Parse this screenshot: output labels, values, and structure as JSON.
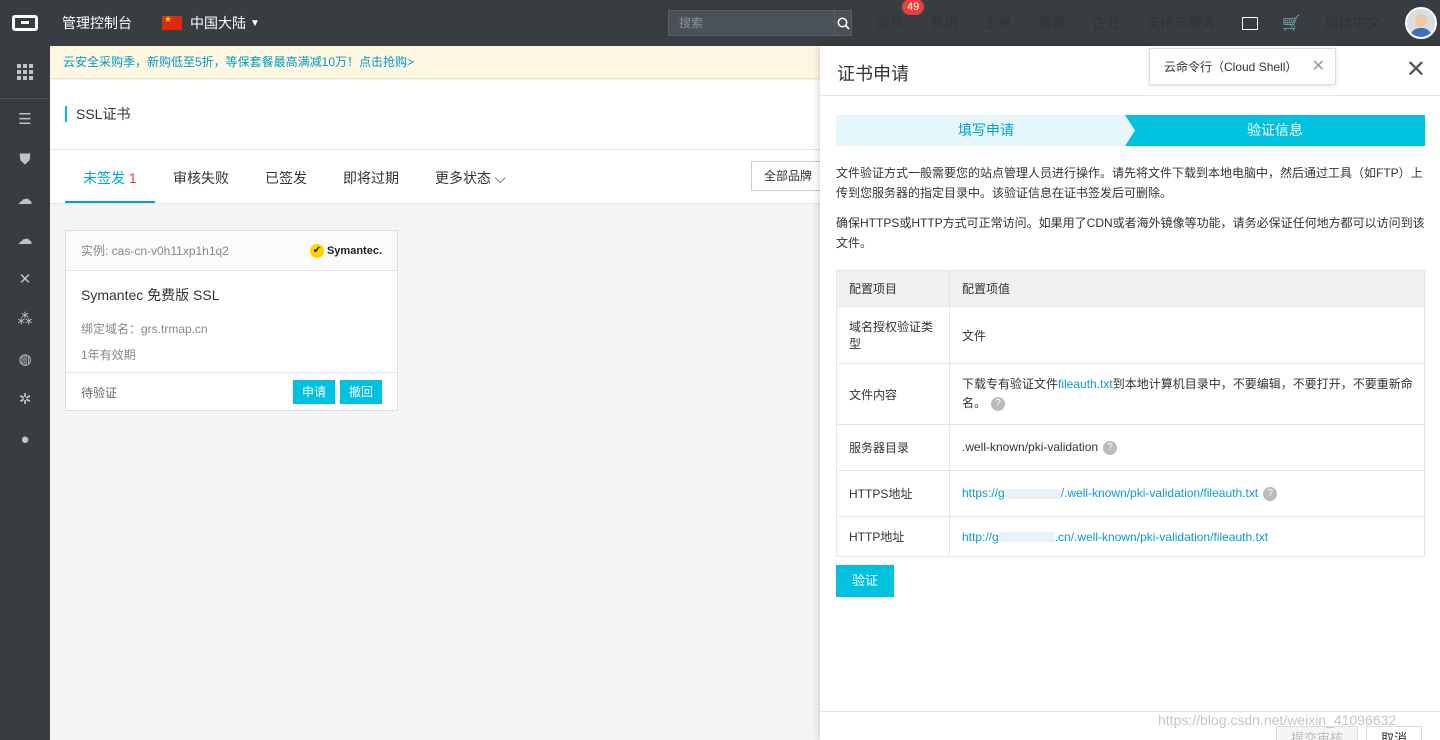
{
  "topbar": {
    "console": "管理控制台",
    "region": "中国大陆",
    "search_placeholder": "搜索",
    "nav": {
      "messages": "消息",
      "messages_badge": "49",
      "billing": "费用",
      "tickets": "工单",
      "icp": "备案",
      "enterprise": "企业",
      "support": "支持与服务",
      "language": "简体中文"
    }
  },
  "promo": "云安全采购季，新购低至5折，等保套餐最高满减10万！点击抢购>",
  "page": {
    "title": "SSL证书",
    "tabs": {
      "unissued": "未签发",
      "unissued_count": "1",
      "failed": "审核失败",
      "issued": "已签发",
      "expiring": "即将过期",
      "more": "更多状态"
    },
    "brand_filter": "全部品牌"
  },
  "card": {
    "instance": "实例: cas-cn-v0h11xp1h1q2",
    "brand": "Symantec.",
    "title": "Symantec 免费版 SSL",
    "domain": "绑定域名：grs.trmap.cn",
    "validity": "1年有效期",
    "status": "待验证",
    "apply": "申请",
    "revoke": "撤回"
  },
  "drawer": {
    "title": "证书申请",
    "tooltip": "云命令行（Cloud Shell）",
    "step1": "填写申请",
    "step2": "验证信息",
    "desc1": "文件验证方式一般需要您的站点管理人员进行操作。请先将文件下载到本地电脑中，然后通过工具（如FTP）上传到您服务器的指定目录中。该验证信息在证书签发后可删除。",
    "desc2": "确保HTTPS或HTTP方式可正常访问。如果用了CDN或者海外镜像等功能，请务必保证任何地方都可以访问到该文件。",
    "table": {
      "col1": "配置项目",
      "col2": "配置项值",
      "rows": {
        "type_label": "域名授权验证类型",
        "type_value": "文件",
        "content_label": "文件内容",
        "content_pre": "下载专有验证文件",
        "content_link": "fileauth.txt",
        "content_post": "到本地计算机目录中，不要编辑，不要打开，不要重新命名。",
        "dir_label": "服务器目录",
        "dir_value": ".well-known/pki-validation",
        "https_label": "HTTPS地址",
        "https_pre": "https://g",
        "https_post": "/.well-known/pki-validation/fileauth.txt",
        "http_label": "HTTP地址",
        "http_pre": "http://g",
        "http_post": ".cn/.well-known/pki-validation/fileauth.txt"
      }
    },
    "verify": "验证",
    "submit": "提交审核",
    "cancel": "取消"
  },
  "watermark": "https://blog.csdn.net/weixin_41096632"
}
